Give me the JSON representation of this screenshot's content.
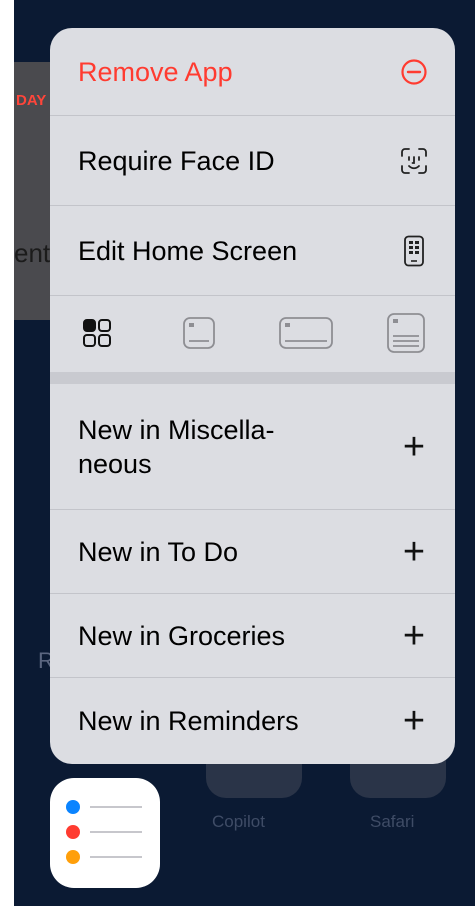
{
  "background": {
    "widget_day_fragment": "DAY",
    "widget_text_fragment": "ent",
    "side_letter": "R",
    "apps": [
      {
        "label": "Copilot"
      },
      {
        "label": "Safari"
      }
    ]
  },
  "menu": {
    "items": [
      {
        "label": "Remove App",
        "icon": "minus-circle-icon",
        "color": "#ff3b30"
      },
      {
        "label": "Require Face ID",
        "icon": "face-id-icon"
      },
      {
        "label": "Edit Home Screen",
        "icon": "phone-icon"
      }
    ],
    "widget_sizes": [
      "app-icon-grid-icon",
      "small-widget-icon",
      "medium-widget-icon",
      "large-widget-icon"
    ],
    "quick_actions": [
      {
        "label": "New in Miscella-\nneous",
        "icon": "plus-icon"
      },
      {
        "label": "New in To Do",
        "icon": "plus-icon"
      },
      {
        "label": "New in Groceries",
        "icon": "plus-icon"
      },
      {
        "label": "New in Reminders",
        "icon": "plus-icon"
      }
    ]
  },
  "app": {
    "name_icon": "reminders-app-icon",
    "dot_colors": [
      "#0a84ff",
      "#ff3b30",
      "#ff9f0a"
    ]
  }
}
